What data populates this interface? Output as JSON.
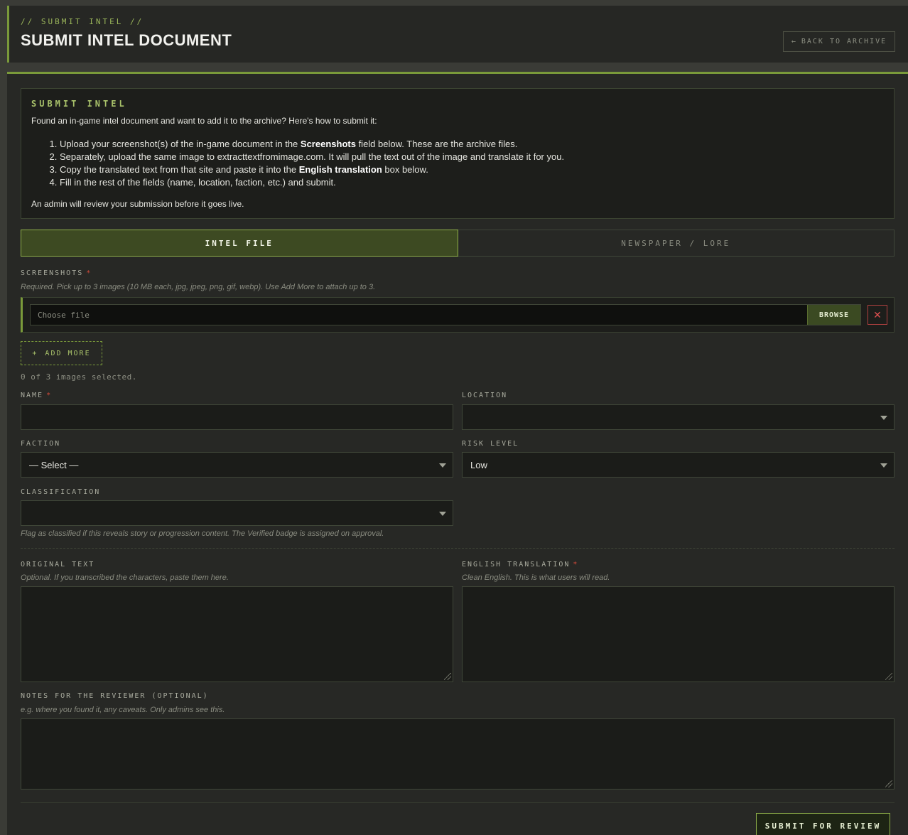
{
  "header": {
    "kicker": "// SUBMIT INTEL //",
    "title": "SUBMIT INTEL DOCUMENT",
    "back_icon": "←",
    "back_label": "BACK TO ARCHIVE"
  },
  "info": {
    "title": "SUBMIT INTEL",
    "intro": "Found an in-game intel document and want to add it to the archive? Here's how to submit it:",
    "steps": [
      {
        "pre": "Upload your screenshot(s) of the in-game document in the ",
        "bold": "Screenshots",
        "post": " field below. These are the archive files."
      },
      {
        "pre": "Separately, upload the same image to extracttextfromimage.com. It will pull the text out of the image and translate it for you.",
        "bold": "",
        "post": ""
      },
      {
        "pre": "Copy the translated text from that site and paste it into the ",
        "bold": "English translation",
        "post": " box below."
      },
      {
        "pre": "Fill in the rest of the fields (name, location, faction, etc.) and submit.",
        "bold": "",
        "post": ""
      }
    ],
    "outro": "An admin will review your submission before it goes live."
  },
  "tabs": {
    "intel": "INTEL FILE",
    "newspaper": "NEWSPAPER / LORE"
  },
  "screenshots": {
    "label": "SCREENSHOTS",
    "required_mark": "*",
    "hint": "Required. Pick up to 3 images (10 MB each, jpg, jpeg, png, gif, webp). Use Add More to attach up to 3.",
    "file_placeholder": "Choose file",
    "browse_label": "BROWSE",
    "remove_icon": "✕",
    "add_more_icon": "+",
    "add_more_label": "ADD MORE",
    "count_text": "0 of 3 images selected."
  },
  "fields": {
    "name_label": "NAME",
    "name_required": "*",
    "location_label": "LOCATION",
    "location_value": "",
    "faction_label": "FACTION",
    "faction_value": "— Select —",
    "risk_label": "RISK LEVEL",
    "risk_value": "Low",
    "classification_label": "CLASSIFICATION",
    "classification_value": "",
    "classification_hint": "Flag as classified if this reveals story or progression content. The Verified badge is assigned on approval."
  },
  "texts": {
    "original_label": "ORIGINAL TEXT",
    "original_hint": "Optional. If you transcribed the characters, paste them here.",
    "translation_label": "ENGLISH TRANSLATION",
    "translation_required": "*",
    "translation_hint": "Clean English. This is what users will read.",
    "notes_label": "NOTES FOR THE REVIEWER (OPTIONAL)",
    "notes_hint": "e.g. where you found it, any caveats. Only admins see this."
  },
  "submit_label": "SUBMIT FOR REVIEW",
  "colors": {
    "accent": "#7a9a3a",
    "required": "#d44a3a",
    "panel": "#272825"
  }
}
